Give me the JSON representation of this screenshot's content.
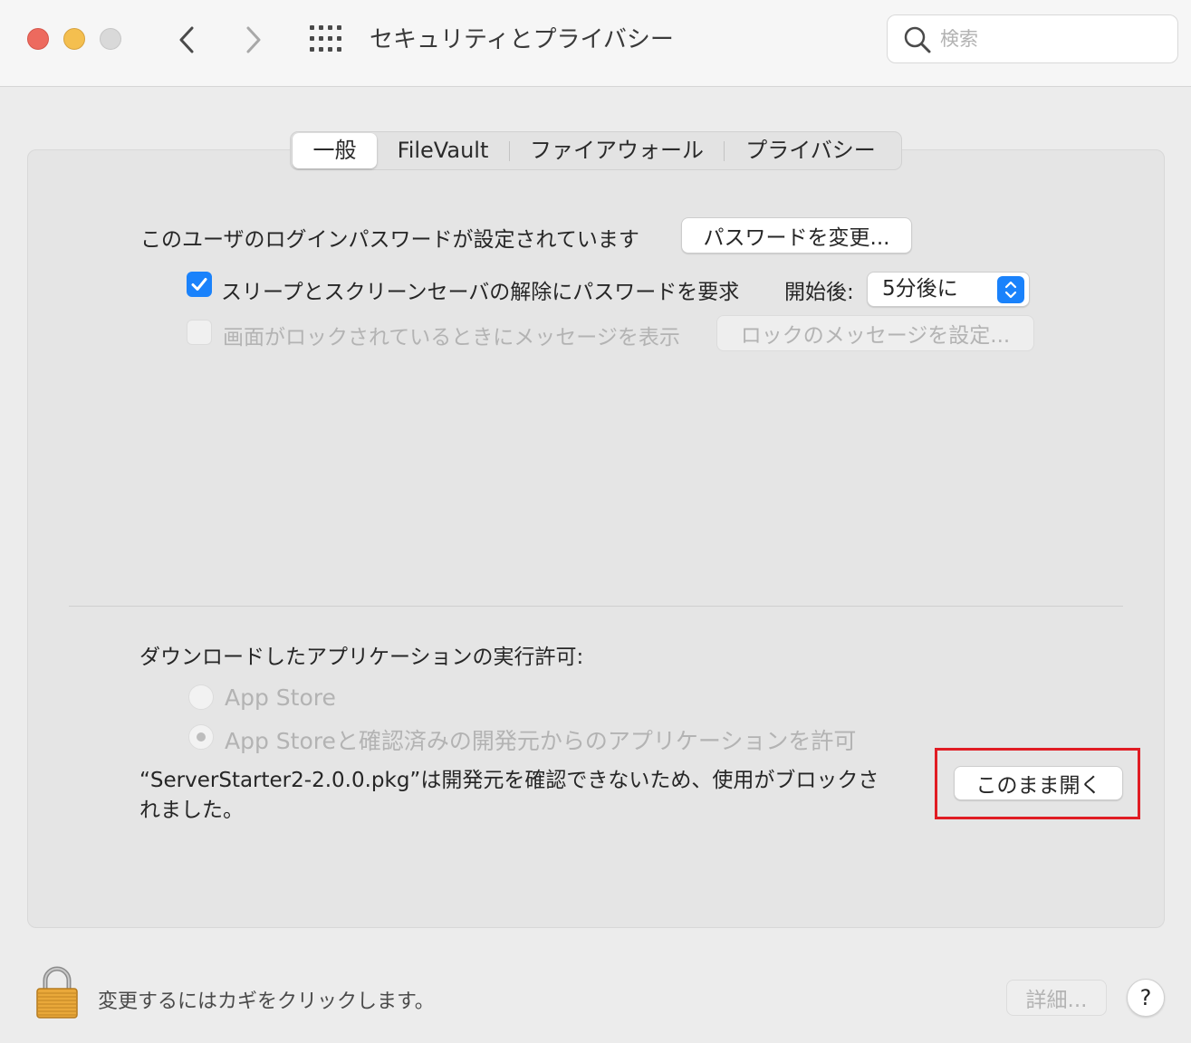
{
  "window": {
    "title": "セキュリティとプライバシー",
    "search_placeholder": "検索"
  },
  "tabs": [
    {
      "label": "一般",
      "active": true
    },
    {
      "label": "FileVault",
      "active": false
    },
    {
      "label": "ファイアウォール",
      "active": false
    },
    {
      "label": "プライバシー",
      "active": false
    }
  ],
  "general": {
    "login_password_text": "このユーザのログインパスワードが設定されています",
    "change_password_button": "パスワードを変更...",
    "require_password_label": "スリープとスクリーンセーバの解除にパスワードを要求",
    "require_password_checked": true,
    "start_after_label": "開始後:",
    "start_after_value": "5分後に",
    "show_message_label": "画面がロックされているときにメッセージを表示",
    "show_message_checked": false,
    "set_lock_message_button": "ロックのメッセージを設定...",
    "allow_apps_heading": "ダウンロードしたアプリケーションの実行許可:",
    "option_app_store": "App Store",
    "option_app_store_identified": "App Storeと確認済みの開発元からのアプリケーションを許可",
    "selected_option": "option_app_store_identified",
    "blocked_message_line1": "“ServerStarter2-2.0.0.pkg”は開発元を確認できないため、使用がブロックさ",
    "blocked_message_line2": "れました。",
    "open_anyway_button": "このまま開く"
  },
  "footer": {
    "lock_text": "変更するにはカギをクリックします。",
    "advanced_button": "詳細...",
    "help_button": "?"
  },
  "colors": {
    "accent": "#1a82fb",
    "highlight_border": "#e01c24",
    "close": "#ed6a5e",
    "minimize": "#f4bf4f",
    "zoom_disabled": "#d9d9d9"
  },
  "icons": {
    "back": "chevron-left-icon",
    "forward": "chevron-right-icon",
    "show_all": "grid-icon",
    "search": "search-icon",
    "lock": "lock-icon",
    "checkbox": "checkmark-icon",
    "select": "updown-chevron-icon"
  }
}
